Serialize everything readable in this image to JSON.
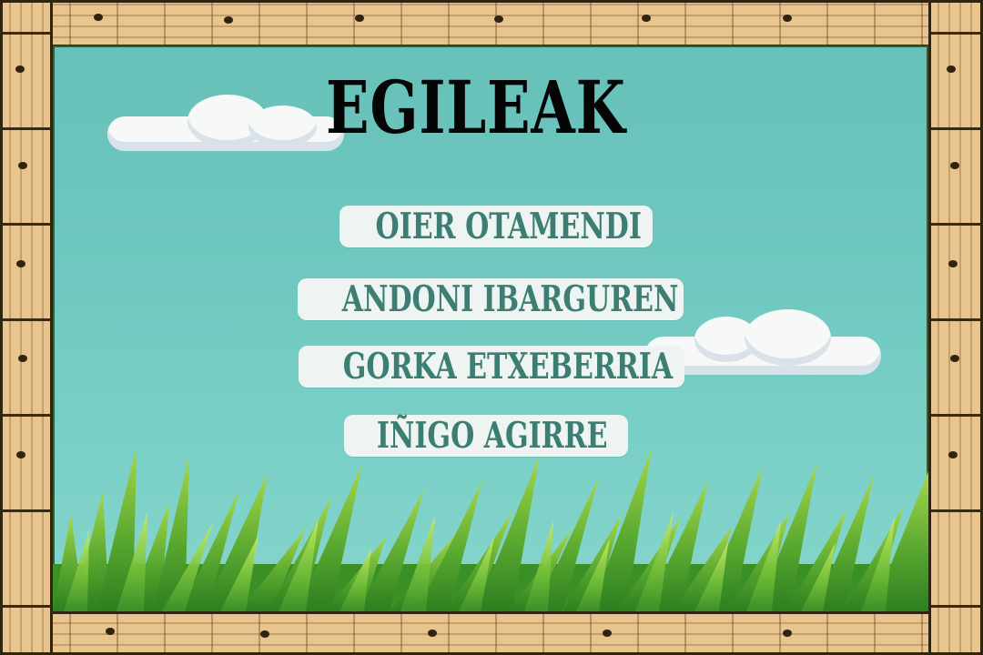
{
  "screen": {
    "title": "EGILEAK",
    "credits": [
      "OIER OTAMENDI",
      "ANDONI IBARGUREN",
      "GORKA ETXEBERRIA",
      "IÑIGO AGIRRE"
    ]
  },
  "colors": {
    "sky": "#6ec7be",
    "name_text": "#3c7d74",
    "name_tag": "#edf4f1",
    "title": "#050505",
    "frame": "#e8c48e"
  }
}
